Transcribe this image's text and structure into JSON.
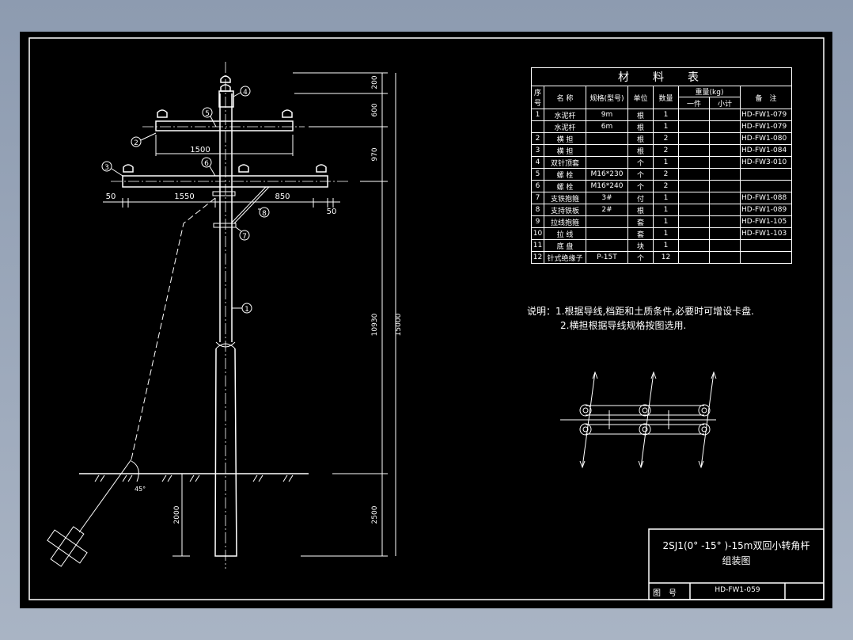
{
  "drawing": {
    "dimensions": {
      "d200": "200",
      "d600": "600",
      "d970": "970",
      "d10930": "10930",
      "d15000": "15000",
      "d2500": "2500",
      "d2000": "2000",
      "d1500": "1500",
      "d1550": "1550",
      "d850": "850",
      "d50a": "50",
      "d50b": "50"
    },
    "callouts": [
      "1",
      "2",
      "3",
      "4",
      "5",
      "6",
      "7",
      "8"
    ],
    "angle_label": "45°"
  },
  "materials": {
    "title": "材　料　表",
    "headers": {
      "no": "序号",
      "name": "名 称",
      "spec": "规格(型号)",
      "unit": "单位",
      "qty": "数量",
      "weight": "重量(kg)",
      "each": "一件",
      "subtotal": "小计",
      "remark": "备　注"
    },
    "rows": [
      {
        "no": "1",
        "name": "水泥杆",
        "spec": "9m",
        "unit": "根",
        "qty": "1",
        "remark": "HD-FW1-079"
      },
      {
        "no": "",
        "name": "水泥杆",
        "spec": "6m",
        "unit": "根",
        "qty": "1",
        "remark": "HD-FW1-079"
      },
      {
        "no": "2",
        "name": "横 担",
        "spec": "",
        "unit": "根",
        "qty": "2",
        "remark": "HD-FW1-080"
      },
      {
        "no": "3",
        "name": "横 担",
        "spec": "",
        "unit": "根",
        "qty": "2",
        "remark": "HD-FW1-084"
      },
      {
        "no": "4",
        "name": "双针顶套",
        "spec": "",
        "unit": "个",
        "qty": "1",
        "remark": "HD-FW3-010"
      },
      {
        "no": "5",
        "name": "螺 栓",
        "spec": "M16*230",
        "unit": "个",
        "qty": "2",
        "remark": ""
      },
      {
        "no": "6",
        "name": "螺 栓",
        "spec": "M16*240",
        "unit": "个",
        "qty": "2",
        "remark": ""
      },
      {
        "no": "7",
        "name": "支铁抱箍",
        "spec": "3#",
        "unit": "付",
        "qty": "1",
        "remark": "HD-FW1-088"
      },
      {
        "no": "8",
        "name": "支持铁板",
        "spec": "2#",
        "unit": "根",
        "qty": "1",
        "remark": "HD-FW1-089"
      },
      {
        "no": "9",
        "name": "拉线抱箍",
        "spec": "",
        "unit": "套",
        "qty": "1",
        "remark": "HD-FW1-105"
      },
      {
        "no": "10",
        "name": "拉 线",
        "spec": "",
        "unit": "套",
        "qty": "1",
        "remark": "HD-FW1-103"
      },
      {
        "no": "11",
        "name": "底 盘",
        "spec": "",
        "unit": "块",
        "qty": "1",
        "remark": ""
      },
      {
        "no": "12",
        "name": "针式绝缘子",
        "spec": "P-15T",
        "unit": "个",
        "qty": "12",
        "remark": ""
      }
    ]
  },
  "notes": {
    "line1": "说明：1.根据导线,档距和土质条件,必要时可增设卡盘.",
    "line2": "2.横担根据导线规格按图选用."
  },
  "title_block": {
    "title_line1": "2SJ1(0° -15° )-15m双回小转角杆",
    "title_line2": "组装图",
    "drawing_no_label": "图　号",
    "drawing_no": "HD-FW1-059"
  }
}
